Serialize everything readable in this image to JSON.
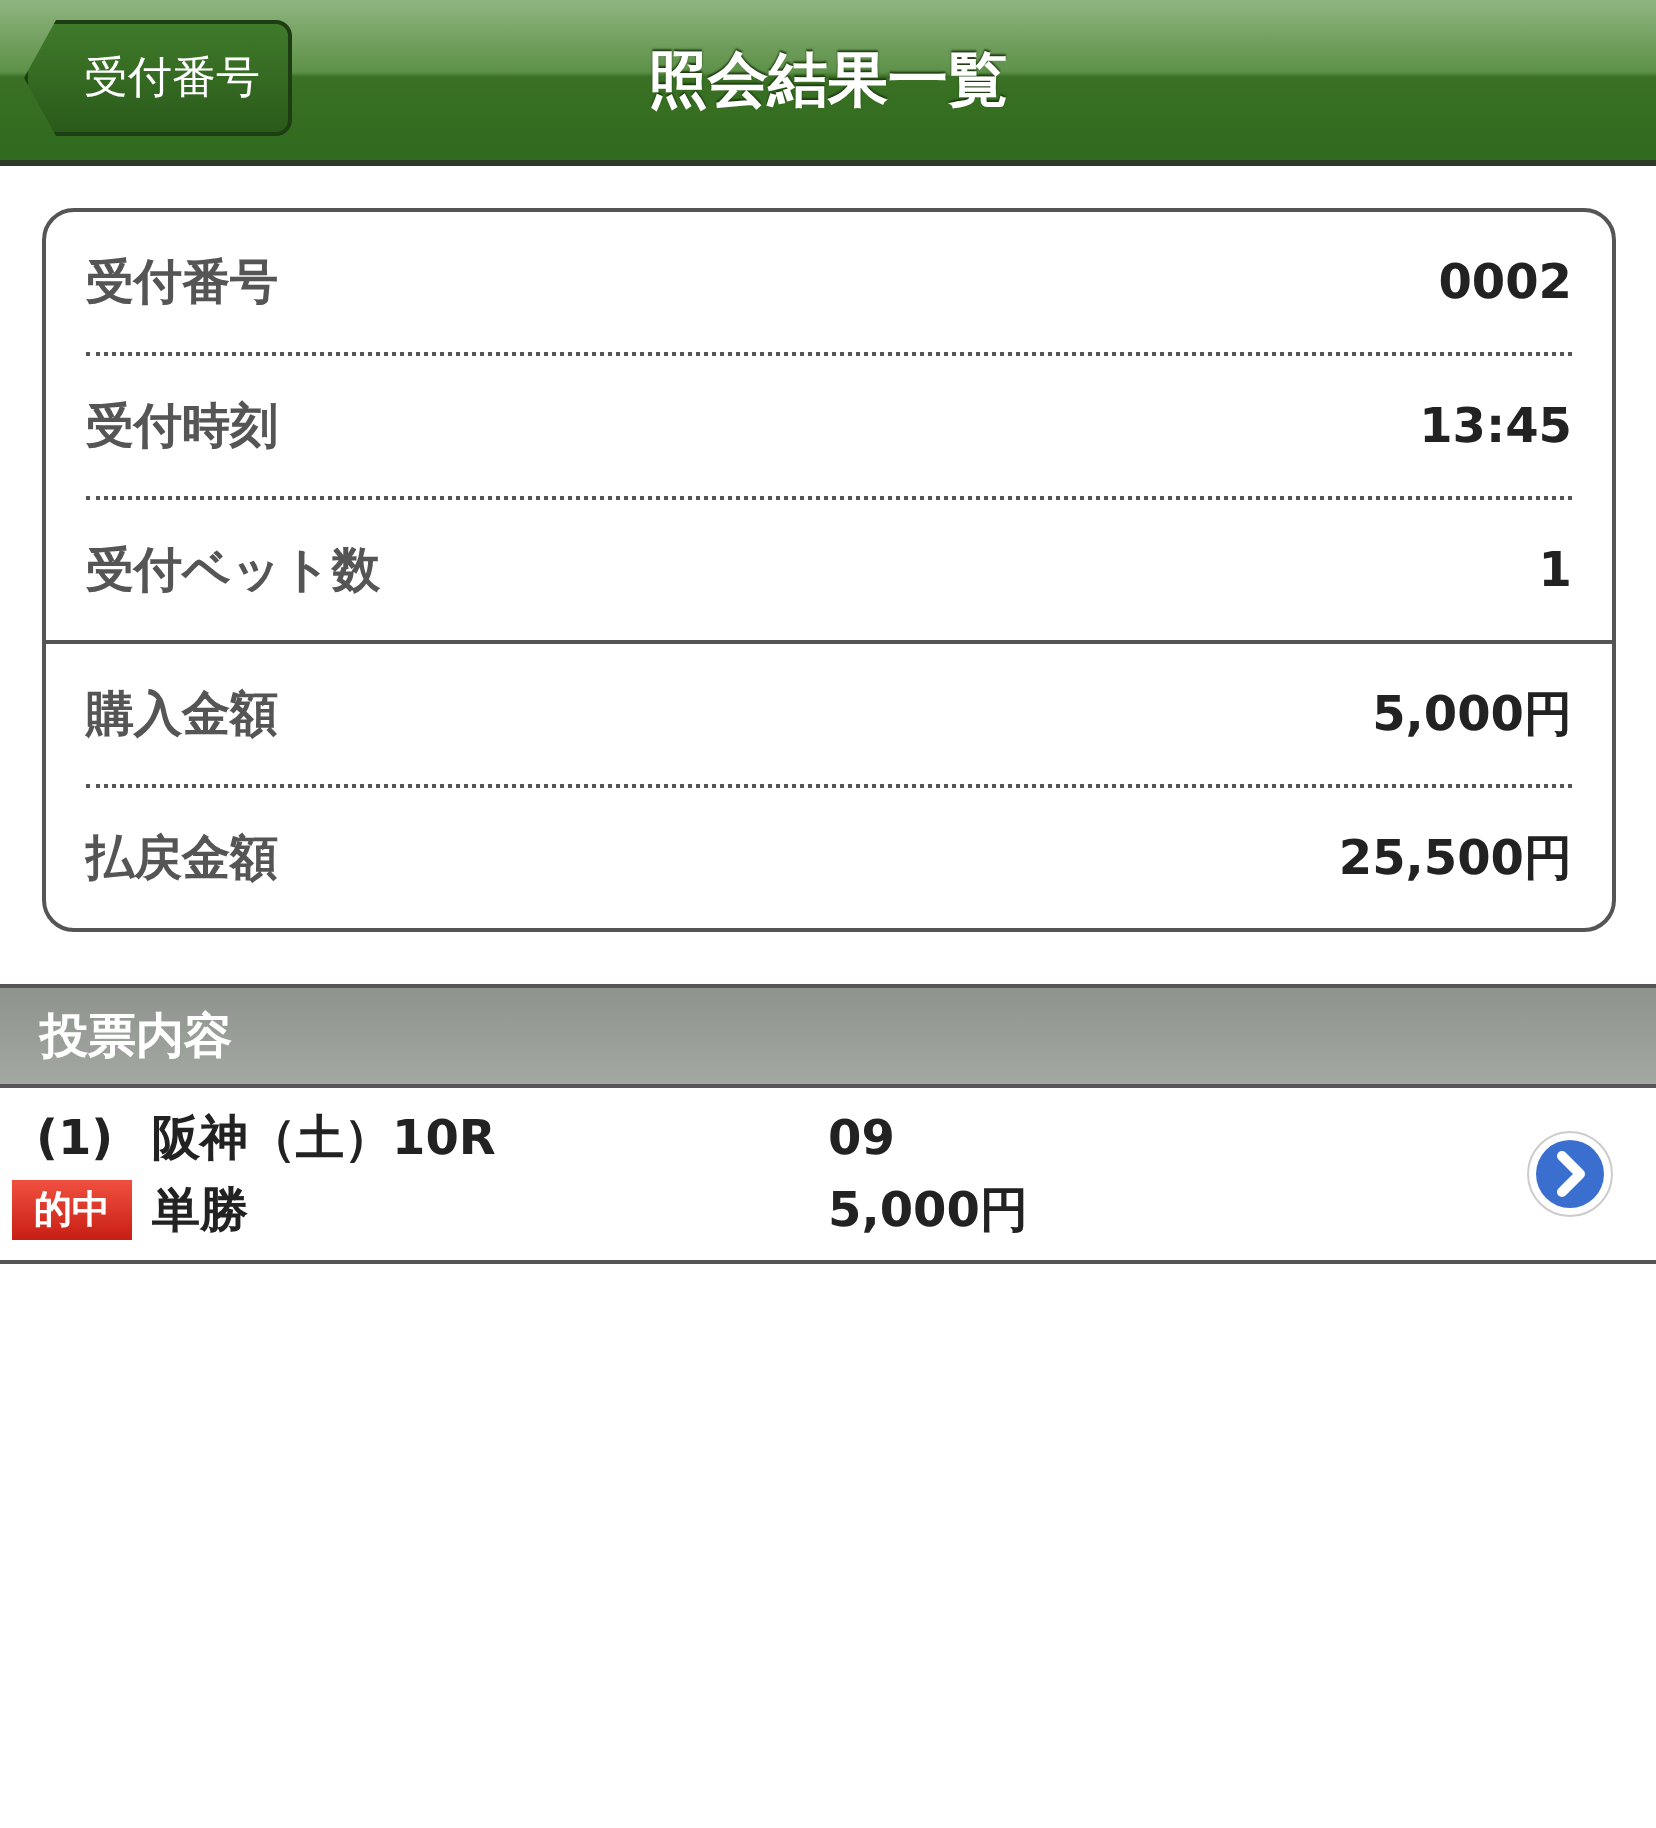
{
  "nav": {
    "back": "受付番号",
    "title": "照会結果一覧"
  },
  "summary": [
    {
      "rows": [
        {
          "label": "受付番号",
          "value": "0002"
        },
        {
          "label": "受付時刻",
          "value": "13:45"
        },
        {
          "label": "受付ベット数",
          "value": "1"
        }
      ]
    },
    {
      "rows": [
        {
          "label": "購入金額",
          "value": "5,000円"
        },
        {
          "label": "払戻金額",
          "value": "25,500円"
        }
      ]
    }
  ],
  "section": {
    "title": "投票内容"
  },
  "bets": [
    {
      "number": "(1)",
      "badge": "的中",
      "race": "阪神（土）10R",
      "bet_type": "単勝",
      "horse": "09",
      "amount": "5,000円"
    }
  ]
}
